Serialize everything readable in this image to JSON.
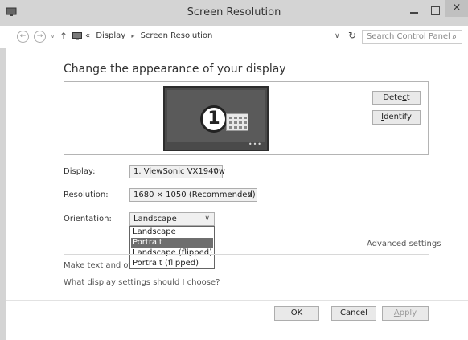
{
  "window": {
    "title": "Screen Resolution",
    "close_glyph": "×"
  },
  "nav": {
    "back_glyph": "←",
    "forward_glyph": "→",
    "up_glyph": "↑",
    "breadcrumb_prefix": "«",
    "breadcrumbs": [
      "Display",
      "Screen Resolution"
    ],
    "separator_glyph": "▸",
    "dropdown_glyph": "∨",
    "refresh_glyph": "↻",
    "search_placeholder": "Search Control Panel",
    "search_glyph": "⌕"
  },
  "main": {
    "heading": "Change the appearance of your display",
    "monitor_number": "1",
    "monitor_dots": "•••",
    "detect_pre": "Dete",
    "detect_key": "c",
    "detect_post": "t",
    "identify_key": "I",
    "identify_post": "dentify"
  },
  "fields": {
    "display_label": "Display:",
    "display_value": "1. ViewSonic VX1940w",
    "resolution_label": "Resolution:",
    "resolution_value": "1680 × 1050 (Recommended)",
    "orientation_label": "Orientation:",
    "orientation_value": "Landscape",
    "arrow_glyph": "∨"
  },
  "orientation_options": [
    "Landscape",
    "Portrait",
    "Landscape (flipped)",
    "Portrait (flipped)"
  ],
  "orientation_highlighted": "Portrait",
  "links": {
    "advanced": "Advanced settings",
    "make_text": "Make text and other",
    "what_settings": "What display settings should I choose?"
  },
  "buttons": {
    "ok": "OK",
    "cancel": "Cancel",
    "apply_key": "A",
    "apply_post": "pply"
  },
  "colors": {
    "titlebar": "#d4d4d4",
    "highlight": "#6e6e6e",
    "monitor": "#4a4a4a"
  }
}
